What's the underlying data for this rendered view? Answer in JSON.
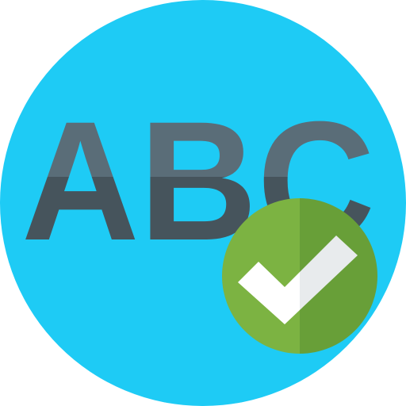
{
  "icon": {
    "text": "ABC",
    "badge": "checkmark-icon",
    "colors": {
      "background_circle": "#1ECBF5",
      "text_top": "#5A6D78",
      "text_bottom": "#46545C",
      "badge_light": "#7CB342",
      "badge_dark": "#689F38",
      "check_light": "#FFFFFF",
      "check_dark": "#E8EBED"
    }
  }
}
